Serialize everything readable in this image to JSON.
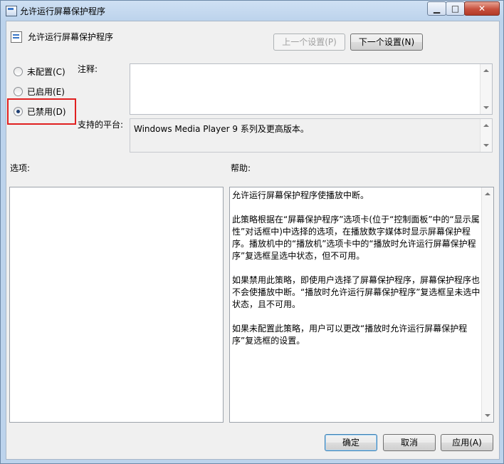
{
  "window": {
    "title": "允许运行屏幕保护程序",
    "minimize_label": "▁",
    "maximize_label": "□",
    "close_label": "✕",
    "icon": "policy-window-icon"
  },
  "policy": {
    "name": "允许运行屏幕保护程序",
    "icon": "policy-settings-icon"
  },
  "nav": {
    "prev_label": "上一个设置(P)",
    "next_label": "下一个设置(N)"
  },
  "state_options": [
    {
      "label": "未配置(C)",
      "checked": false
    },
    {
      "label": "已启用(E)",
      "checked": false
    },
    {
      "label": "已禁用(D)",
      "checked": true
    }
  ],
  "comment": {
    "label": "注释:",
    "value": ""
  },
  "supported": {
    "label": "支持的平台:",
    "value": "Windows Media Player 9 系列及更高版本。"
  },
  "options": {
    "label": "选项:"
  },
  "help": {
    "label": "帮助:",
    "paragraphs": [
      "允许运行屏幕保护程序使播放中断。",
      "此策略根据在“屏幕保护程序”选项卡(位于“控制面板”中的“显示属性”对话框中)中选择的选项，在播放数字媒体时显示屏幕保护程序。播放机中的“播放机”选项卡中的“播放时允许运行屏幕保护程序”复选框呈选中状态，但不可用。",
      "如果禁用此策略，即使用户选择了屏幕保护程序，屏幕保护程序也不会使播放中断。“播放时允许运行屏幕保护程序”复选框呈未选中状态，且不可用。",
      "如果未配置此策略，用户可以更改“播放时允许运行屏幕保护程序”复选框的设置。"
    ]
  },
  "footer": {
    "ok_label": "确定",
    "cancel_label": "取消",
    "apply_label": "应用(A)"
  },
  "colors": {
    "highlight_border": "#e02020",
    "title_gradient_top": "#cfe0f3",
    "close_button": "#c7503d"
  }
}
